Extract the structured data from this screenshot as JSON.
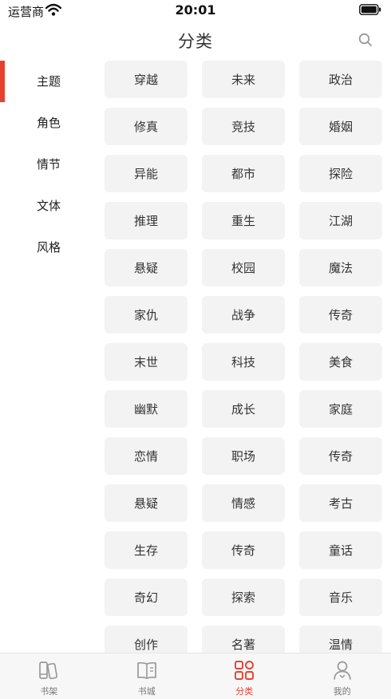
{
  "status_bar": {
    "carrier": "运营商",
    "time": "20:01"
  },
  "header": {
    "title": "分类"
  },
  "colors": {
    "accent": "#e8402f",
    "tag_bg": "#f3f3f3",
    "tabbar_bg": "#f7f7f7"
  },
  "sidebar": {
    "items": [
      {
        "label": "主题",
        "active": true
      },
      {
        "label": "角色",
        "active": false
      },
      {
        "label": "情节",
        "active": false
      },
      {
        "label": "文体",
        "active": false
      },
      {
        "label": "风格",
        "active": false
      }
    ]
  },
  "tags": [
    "穿越",
    "未来",
    "政治",
    "修真",
    "竞技",
    "婚姻",
    "异能",
    "都市",
    "探险",
    "推理",
    "重生",
    "江湖",
    "悬疑",
    "校园",
    "魔法",
    "家仇",
    "战争",
    "传奇",
    "末世",
    "科技",
    "美食",
    "幽默",
    "成长",
    "家庭",
    "恋情",
    "职场",
    "传奇",
    "悬疑",
    "情感",
    "考古",
    "生存",
    "传奇",
    "童话",
    "奇幻",
    "探索",
    "音乐",
    "创作",
    "名著",
    "温情"
  ],
  "tabbar": {
    "tabs": [
      {
        "label": "书架",
        "icon": "bookshelf-icon",
        "active": false
      },
      {
        "label": "书城",
        "icon": "book-store-icon",
        "active": false
      },
      {
        "label": "分类",
        "icon": "category-icon",
        "active": true
      },
      {
        "label": "我的",
        "icon": "profile-icon",
        "active": false
      }
    ]
  }
}
